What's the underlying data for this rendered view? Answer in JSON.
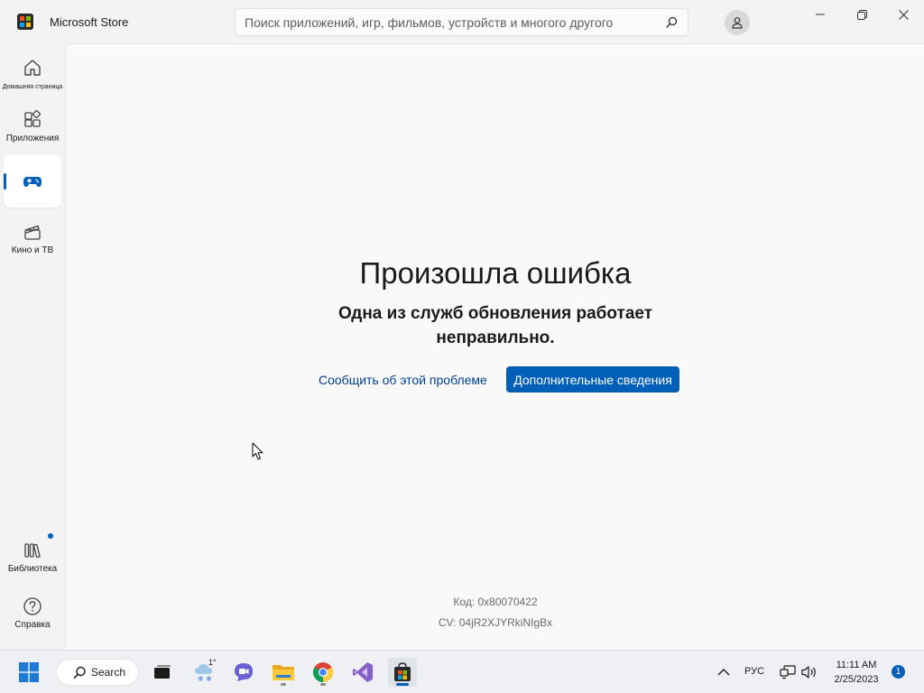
{
  "window": {
    "title": "Microsoft Store",
    "search_placeholder": "Поиск приложений, игр, фильмов, устройств и многого другого"
  },
  "sidebar": {
    "items": [
      {
        "label": "Домашняя страница",
        "icon": "home-icon"
      },
      {
        "label": "Приложения",
        "icon": "apps-icon"
      },
      {
        "label": "",
        "icon": "gamepad-icon",
        "active": true
      },
      {
        "label": "Кино и ТВ",
        "icon": "film-icon"
      },
      {
        "label": "Библиотека",
        "icon": "library-icon",
        "has_update_dot": true
      },
      {
        "label": "Справка",
        "icon": "help-icon"
      }
    ]
  },
  "error": {
    "title": "Произошла ошибка",
    "subtitle": "Одна из служб обновления работает неправильно.",
    "report_label": "Сообщить об этой проблеме",
    "details_label": "Дополнительные сведения",
    "code": "Код: 0x80070422",
    "cv": "CV: 04jR2XJYRkiNIgBx"
  },
  "taskbar": {
    "search_label": "Search",
    "weather_temp": "1°",
    "language": "РУС",
    "time": "11:11 AM",
    "date": "2/25/2023",
    "notification_count": "1"
  },
  "colors": {
    "accent": "#005fb8",
    "link": "#003e92",
    "background": "#f9f9f9",
    "chrome": "#f3f3f3"
  }
}
